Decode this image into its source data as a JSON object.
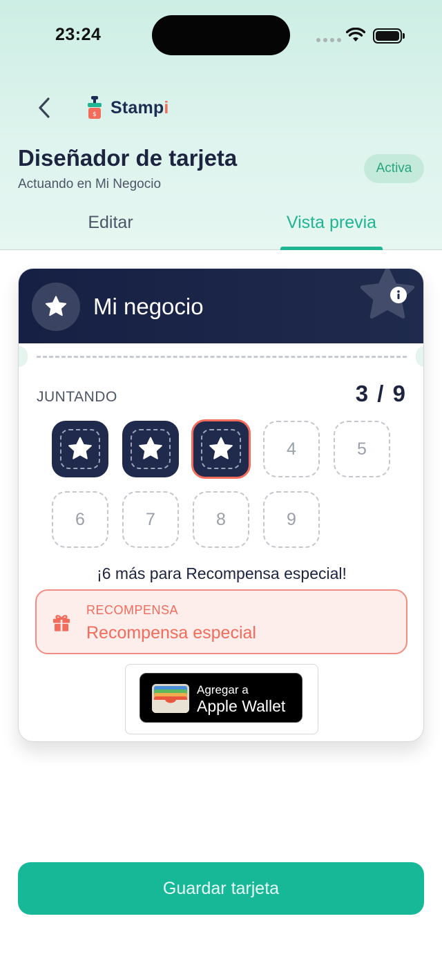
{
  "status_bar": {
    "time": "23:24"
  },
  "header": {
    "logo_prefix": "Stamp",
    "logo_suffix": "i",
    "title": "Diseñador de tarjeta",
    "subtitle": "Actuando en Mi Negocio",
    "status": "Activa"
  },
  "tabs": [
    {
      "label": "Editar",
      "active": false
    },
    {
      "label": "Vista previa",
      "active": true
    }
  ],
  "card": {
    "business_name": "Mi negocio",
    "collect_label": "JUNTANDO",
    "count": "3 / 9",
    "stamps_collected": 3,
    "stamps_total": 9,
    "empty_stamps": [
      "4",
      "5",
      "6",
      "7",
      "8",
      "9"
    ],
    "remaining_text": "¡6 más para Recompensa especial!",
    "reward": {
      "label": "RECOMPENSA",
      "name": "Recompensa especial"
    },
    "wallet": {
      "line1": "Agregar a",
      "line2": "Apple Wallet"
    }
  },
  "save_button": "Guardar tarjeta",
  "colors": {
    "accent": "#1fb592",
    "card_header": "#1f2a4c",
    "reward": "#f26b5b"
  }
}
